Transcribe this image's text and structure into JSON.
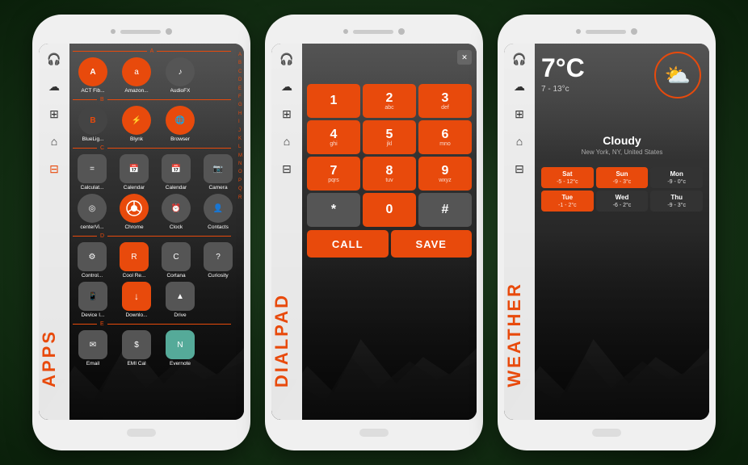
{
  "phones": [
    {
      "id": "apps",
      "label": "APPS",
      "sidebar": {
        "icons": [
          "🎧",
          "☁",
          "⊞",
          "⌂",
          "⊟"
        ]
      },
      "alphabet": [
        "A",
        "B",
        "C",
        "D",
        "E",
        "F",
        "G",
        "H",
        "I",
        "J",
        "K",
        "L",
        "M",
        "N",
        "O",
        "P",
        "Q",
        "R"
      ],
      "sections": [
        {
          "letter": "A",
          "apps": [
            {
              "name": "ACT Fib...",
              "bg": "#e84a0c",
              "icon": "A"
            },
            {
              "name": "Amazon...",
              "bg": "#e84a0c",
              "icon": "a"
            },
            {
              "name": "AudioFX",
              "bg": "#333",
              "icon": "♪"
            }
          ]
        },
        {
          "letter": "B",
          "apps": [
            {
              "name": "BlueLig...",
              "bg": "#e84a0c",
              "icon": "B"
            },
            {
              "name": "Blynk",
              "bg": "#e84a0c",
              "icon": "⚡"
            },
            {
              "name": "Browser",
              "bg": "#e84a0c",
              "icon": "🌐"
            }
          ]
        },
        {
          "letter": "C",
          "apps": [
            {
              "name": "Calculat...",
              "bg": "#444",
              "icon": "="
            },
            {
              "name": "Calendar",
              "bg": "#444",
              "icon": "📅"
            },
            {
              "name": "Calendar",
              "bg": "#444",
              "icon": "📅"
            },
            {
              "name": "Camera",
              "bg": "#444",
              "icon": "📷"
            }
          ]
        },
        {
          "letter": "",
          "apps": [
            {
              "name": "centerVi...",
              "bg": "#444",
              "icon": "◎"
            },
            {
              "name": "Chrome",
              "bg": "#e84a0c",
              "icon": "C"
            },
            {
              "name": "Clock",
              "bg": "#444",
              "icon": "⏰"
            },
            {
              "name": "Contacts",
              "bg": "#444",
              "icon": "👤"
            }
          ]
        },
        {
          "letter": "D",
          "apps": [
            {
              "name": "Control...",
              "bg": "#444",
              "icon": "⚙"
            },
            {
              "name": "Cool Re...",
              "bg": "#e84a0c",
              "icon": "R"
            },
            {
              "name": "Cortana",
              "bg": "#444",
              "icon": "C"
            },
            {
              "name": "Curiosity",
              "bg": "#444",
              "icon": "?"
            }
          ]
        },
        {
          "letter": "",
          "apps": [
            {
              "name": "Device I...",
              "bg": "#444",
              "icon": "📱"
            },
            {
              "name": "Downlo...",
              "bg": "#e84a0c",
              "icon": "↓"
            },
            {
              "name": "Drive",
              "bg": "#444",
              "icon": "▲"
            }
          ]
        },
        {
          "letter": "E",
          "apps": [
            {
              "name": "Email",
              "bg": "#444",
              "icon": "✉"
            },
            {
              "name": "EMI Cal",
              "bg": "#444",
              "icon": "💰"
            },
            {
              "name": "Evernote",
              "bg": "#444",
              "icon": "N"
            }
          ]
        }
      ]
    },
    {
      "id": "dialpad",
      "label": "DIALPAD",
      "sidebar": {
        "icons": [
          "🎧",
          "☁",
          "⊞",
          "⌂",
          "⊟"
        ]
      },
      "buttons": [
        {
          "number": "1",
          "letters": ""
        },
        {
          "number": "2",
          "letters": "abc"
        },
        {
          "number": "3",
          "letters": "def"
        },
        {
          "number": "4",
          "letters": "ghi"
        },
        {
          "number": "5",
          "letters": "jkl"
        },
        {
          "number": "6",
          "letters": "mno"
        },
        {
          "number": "7",
          "letters": "pqrs"
        },
        {
          "number": "8",
          "letters": "tuv"
        },
        {
          "number": "9",
          "letters": "wxyz"
        },
        {
          "number": "*",
          "letters": ""
        },
        {
          "number": "0",
          "letters": ""
        },
        {
          "number": "#",
          "letters": ""
        }
      ],
      "actions": [
        "CALL",
        "SAVE"
      ]
    },
    {
      "id": "weather",
      "label": "WEATHER",
      "sidebar": {
        "icons": [
          "🎧",
          "☁",
          "⊞",
          "⌂",
          "⊟"
        ]
      },
      "current": {
        "temp": "7°C",
        "range": "7 - 13°c",
        "condition": "Cloudy",
        "location": "New York, NY, United States"
      },
      "days": [
        {
          "name": "Sat",
          "temp": "-5 - 12°c",
          "highlighted": true
        },
        {
          "name": "Sun",
          "temp": "-9 - 3°c",
          "highlighted": true
        },
        {
          "name": "Mon",
          "temp": "-9 - 0°c",
          "highlighted": false
        },
        {
          "name": "Tue",
          "temp": "-1 - 2°c",
          "highlighted": true
        },
        {
          "name": "Wed",
          "temp": "-6 - 2°c",
          "highlighted": false
        },
        {
          "name": "Thu",
          "temp": "-9 - 3°c",
          "highlighted": false
        }
      ]
    }
  ]
}
